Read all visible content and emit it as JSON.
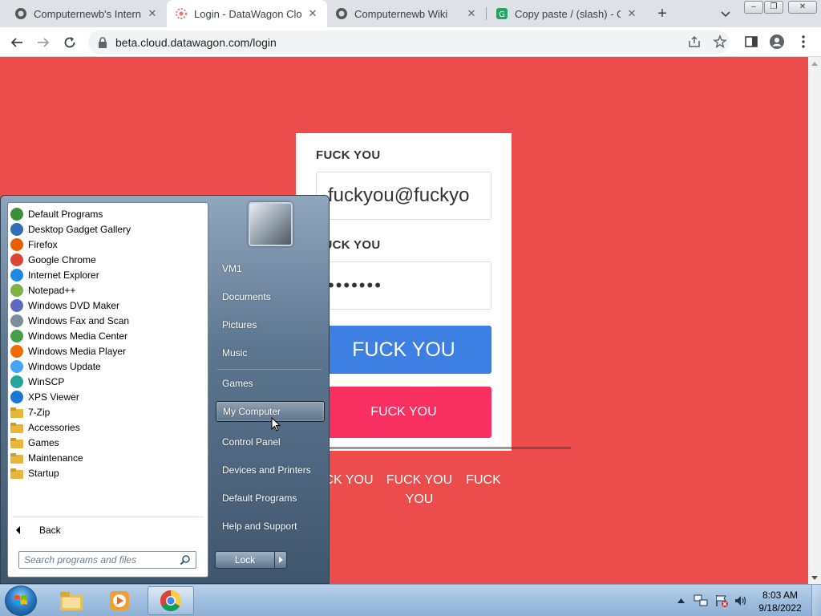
{
  "browser": {
    "tabs": [
      {
        "label": "Computernewb's Internet"
      },
      {
        "label": "Login - DataWagon Cloud"
      },
      {
        "label": "Computernewb Wiki"
      },
      {
        "label": "Copy paste / (slash) - Gly"
      }
    ],
    "close_glyph": "✕",
    "new_tab_glyph": "+",
    "url": "beta.cloud.datawagon.com/login",
    "window_buttons": {
      "minimize": "–",
      "maximize": "❐",
      "close": "✕"
    }
  },
  "login_page": {
    "background_color": "#ec4c4c",
    "email_label": "FUCK YOU",
    "email_value": "fuckyou@fuckyo",
    "password_label": "FUCK YOU",
    "password_value": "•••••••",
    "password_label_visible": "UCK YOU",
    "password_value_visible": "•••••••",
    "primary_button": "FUCK YOU",
    "secondary_button": "FUCK YOU",
    "links": [
      "CK YOU",
      "FUCK YOU",
      "FUCK"
    ],
    "link_two_line1": "FUCK YOU",
    "link_two_line2": "YOU"
  },
  "start_menu": {
    "programs": [
      {
        "label": "Default Programs",
        "icon": "default-programs-icon",
        "color": "#3a8f3a"
      },
      {
        "label": "Desktop Gadget Gallery",
        "icon": "gadget-icon",
        "color": "#2e6fb5"
      },
      {
        "label": "Firefox",
        "icon": "firefox-icon",
        "color": "#e66000"
      },
      {
        "label": "Google Chrome",
        "icon": "chrome-icon",
        "color": "#db4437"
      },
      {
        "label": "Internet Explorer",
        "icon": "ie-icon",
        "color": "#1e88e5"
      },
      {
        "label": "Notepad++",
        "icon": "notepadpp-icon",
        "color": "#7cb342"
      },
      {
        "label": "Windows DVD Maker",
        "icon": "dvd-maker-icon",
        "color": "#5c6bc0"
      },
      {
        "label": "Windows Fax and Scan",
        "icon": "fax-icon",
        "color": "#78909c"
      },
      {
        "label": "Windows Media Center",
        "icon": "media-center-icon",
        "color": "#43a047"
      },
      {
        "label": "Windows Media Player",
        "icon": "media-player-icon",
        "color": "#ef6c00"
      },
      {
        "label": "Windows Update",
        "icon": "windows-update-icon",
        "color": "#42a5f5"
      },
      {
        "label": "WinSCP",
        "icon": "winscp-icon",
        "color": "#26a69a"
      },
      {
        "label": "XPS Viewer",
        "icon": "xps-viewer-icon",
        "color": "#1976d2"
      },
      {
        "label": "7-Zip",
        "icon": "folder-icon",
        "color": "#e8b73a"
      },
      {
        "label": "Accessories",
        "icon": "folder-icon",
        "color": "#e8b73a"
      },
      {
        "label": "Games",
        "icon": "folder-icon",
        "color": "#e8b73a"
      },
      {
        "label": "Maintenance",
        "icon": "folder-icon",
        "color": "#e8b73a"
      },
      {
        "label": "Startup",
        "icon": "folder-icon",
        "color": "#e8b73a"
      }
    ],
    "back_label": "Back",
    "search_placeholder": "Search programs and files",
    "right_items": [
      "VM1",
      "Documents",
      "Pictures",
      "Music",
      "Games",
      "My Computer",
      "Control Panel",
      "Devices and Printers",
      "Default Programs",
      "Help and Support"
    ],
    "highlighted_item": "My Computer",
    "lock_label": "Lock"
  },
  "taskbar": {
    "time": "8:03 AM",
    "date": "9/18/2022"
  }
}
